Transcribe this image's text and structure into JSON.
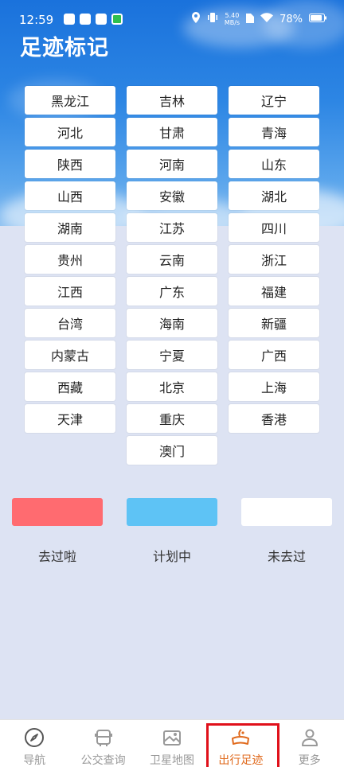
{
  "status": {
    "time": "12:59",
    "net_speed_value": "5.40",
    "net_speed_unit": "MB/s",
    "battery": "78%"
  },
  "header": {
    "title": "足迹标记"
  },
  "provinces": [
    "黑龙江",
    "吉林",
    "辽宁",
    "河北",
    "甘肃",
    "青海",
    "陕西",
    "河南",
    "山东",
    "山西",
    "安徽",
    "湖北",
    "湖南",
    "江苏",
    "四川",
    "贵州",
    "云南",
    "浙江",
    "江西",
    "广东",
    "福建",
    "台湾",
    "海南",
    "新疆",
    "内蒙古",
    "宁夏",
    "广西",
    "西藏",
    "北京",
    "上海",
    "天津",
    "重庆",
    "香港",
    "澳门"
  ],
  "legend": [
    {
      "label": "去过啦",
      "color": "#ff6b70"
    },
    {
      "label": "计划中",
      "color": "#5ec3f5"
    },
    {
      "label": "未去过",
      "color": "#ffffff"
    }
  ],
  "tabs": [
    {
      "label": "导航",
      "icon": "compass-icon"
    },
    {
      "label": "公交查询",
      "icon": "bus-icon"
    },
    {
      "label": "卫星地图",
      "icon": "map-icon"
    },
    {
      "label": "出行足迹",
      "icon": "footprint-icon",
      "active": true
    },
    {
      "label": "更多",
      "icon": "user-icon"
    }
  ],
  "colors": {
    "accent": "#e06a1d",
    "sky": "#1a72dc",
    "background": "#dde3f3"
  }
}
